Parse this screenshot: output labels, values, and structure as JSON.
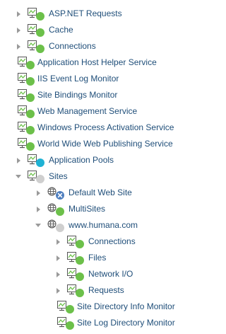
{
  "tree": [
    {
      "label": "ASP.NET Requests",
      "icon": "monitor-icon",
      "status": "up",
      "expand": "collapsed"
    },
    {
      "label": "Cache",
      "icon": "monitor-icon",
      "status": "up",
      "expand": "collapsed"
    },
    {
      "label": "Connections",
      "icon": "monitor-icon",
      "status": "up",
      "expand": "collapsed"
    },
    {
      "label": "Application Host Helper Service",
      "icon": "monitor-icon",
      "status": "up",
      "expand": "none"
    },
    {
      "label": "IIS Event Log Monitor",
      "icon": "monitor-icon",
      "status": "up",
      "expand": "none"
    },
    {
      "label": "Site Bindings Monitor",
      "icon": "monitor-icon",
      "status": "up",
      "expand": "none"
    },
    {
      "label": "Web Management Service",
      "icon": "monitor-icon",
      "status": "up",
      "expand": "none"
    },
    {
      "label": "Windows Process Activation Service",
      "icon": "monitor-icon",
      "status": "up",
      "expand": "none"
    },
    {
      "label": "World Wide Web Publishing Service",
      "icon": "monitor-icon",
      "status": "up",
      "expand": "none"
    },
    {
      "label": "Application Pools",
      "icon": "monitor-icon",
      "status": "info",
      "expand": "collapsed"
    },
    {
      "label": "Sites",
      "icon": "monitor-icon",
      "status": "unknown",
      "expand": "expanded"
    },
    {
      "label": "Default Web Site",
      "icon": "globe-icon",
      "status": "down",
      "expand": "collapsed"
    },
    {
      "label": "MultiSites",
      "icon": "globe-icon",
      "status": "up",
      "expand": "collapsed"
    },
    {
      "label": "www.humana.com",
      "icon": "globe-icon",
      "status": "unknown",
      "expand": "expanded"
    },
    {
      "label": "Connections",
      "icon": "monitor-icon",
      "status": "up",
      "expand": "collapsed"
    },
    {
      "label": "Files",
      "icon": "monitor-icon",
      "status": "up",
      "expand": "collapsed"
    },
    {
      "label": "Network I/O",
      "icon": "monitor-icon",
      "status": "up",
      "expand": "collapsed"
    },
    {
      "label": "Requests",
      "icon": "monitor-icon",
      "status": "up",
      "expand": "collapsed"
    },
    {
      "label": "Site Directory Info Monitor",
      "icon": "monitor-icon",
      "status": "up",
      "expand": "none"
    },
    {
      "label": "Site Log Directory Monitor",
      "icon": "monitor-icon",
      "status": "up",
      "expand": "none"
    }
  ],
  "status_colors": {
    "up": "#6cc04a",
    "info": "#1fb2d4",
    "unknown": "#cfcfcf",
    "down": "#4f7fbf"
  }
}
